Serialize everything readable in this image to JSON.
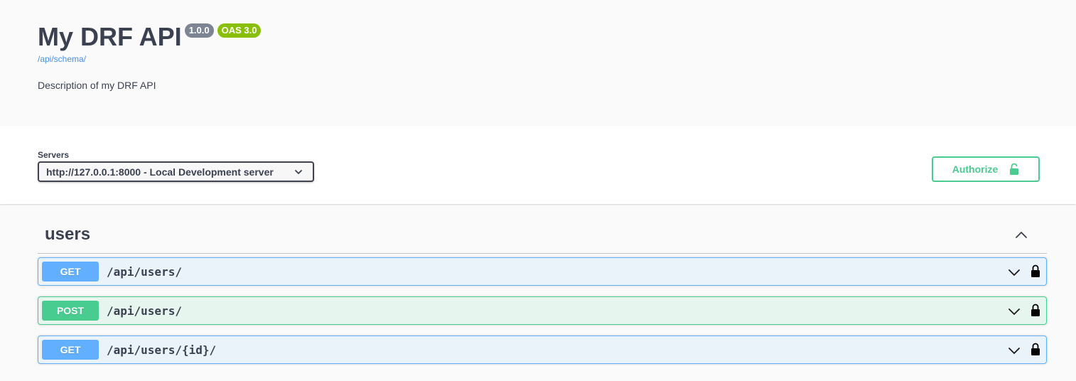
{
  "info": {
    "title": "My DRF API",
    "version_badge": "1.0.0",
    "oas_badge": "OAS 3.0",
    "schema_link": "/api/schema/",
    "description": "Description of my DRF API"
  },
  "servers": {
    "label": "Servers",
    "selected": "http://127.0.0.1:8000 - Local Development server"
  },
  "authorize": {
    "label": "Authorize"
  },
  "tag": {
    "name": "users"
  },
  "operations": [
    {
      "method": "GET",
      "path": "/api/users/"
    },
    {
      "method": "POST",
      "path": "/api/users/"
    },
    {
      "method": "GET",
      "path": "/api/users/{id}/"
    }
  ],
  "colors": {
    "get": "#61affe",
    "post": "#49cc90",
    "authorize": "#49cc90",
    "oas_badge": "#89bf04",
    "version_badge": "#7d8492",
    "link": "#4990e2"
  },
  "icons": {
    "server_dropdown": "chevron-down-icon",
    "authorize": "unlocked-padlock-icon",
    "tag_toggle": "chevron-up-icon",
    "operation_expand": "chevron-down-icon",
    "operation_auth": "locked-padlock-icon"
  }
}
